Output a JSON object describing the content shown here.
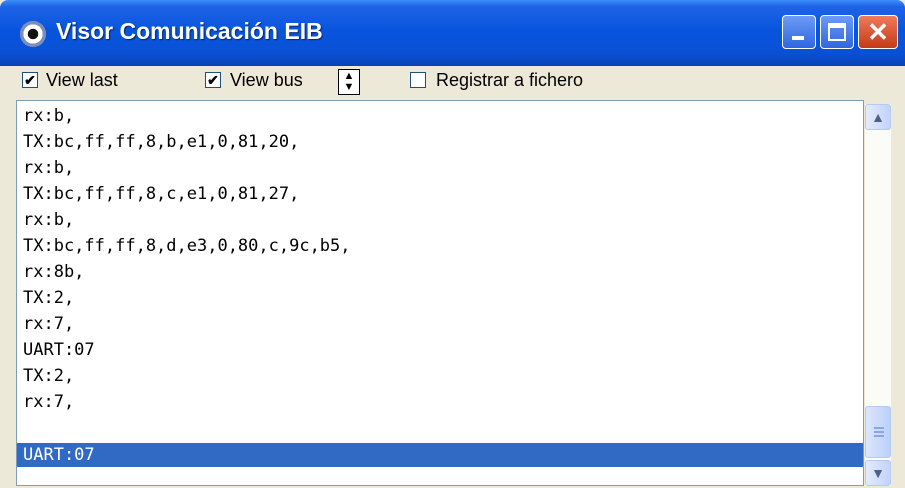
{
  "window": {
    "title": "Visor Comunicación EIB",
    "icon": "eye-icon",
    "controls": [
      "minimize-icon",
      "maximize-icon",
      "close-icon"
    ]
  },
  "toolbar": {
    "view_last": {
      "label": "View last",
      "checked": true
    },
    "view_bus": {
      "label": "View bus",
      "checked": true
    },
    "spinner_icon": "up-down-arrows-icon",
    "registrar": {
      "label": "Registrar a fichero",
      "checked": false
    },
    "check_mark": "✔"
  },
  "log": {
    "rows": [
      "rx:b,",
      "TX:bc,ff,ff,8,b,e1,0,81,20,",
      "rx:b,",
      "TX:bc,ff,ff,8,c,e1,0,81,27,",
      "rx:b,",
      "TX:bc,ff,ff,8,d,e3,0,80,c,9c,b5,",
      "rx:8b,",
      "TX:2,",
      "rx:7,",
      "UART:07",
      "TX:2,",
      "rx:7,",
      "UART:07"
    ],
    "selected_index": 12
  },
  "colors": {
    "titlebar": "#0a50d6",
    "selection": "#316ac5",
    "close_button": "#d4491f"
  }
}
